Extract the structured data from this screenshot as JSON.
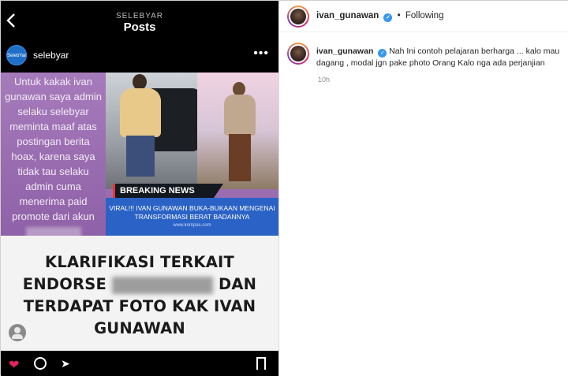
{
  "left_post": {
    "header_subtitle": "SELEBYAR",
    "header_title": "Posts",
    "avatar_text": "SelebYar",
    "account_name": "selebyar",
    "apology_text": "Untuk kakak ivan gunawan saya admin selaku selebyar meminta maaf atas postingan berita hoax, karena saya tidak tau selaku admin cuma menerima paid promote dari akun",
    "breaking_news": "BREAKING NEWS",
    "news_headline": "VIRAL!!! IVAN GUNAWAN BUKA-BUKAAN MENGENAI TRANSFORMASI BERAT BADANNYA",
    "news_source": "www.kompas.com",
    "klarifikasi_line1": "KLARIFIKASI TERKAIT",
    "klarifikasi_line2a": "ENDORSE",
    "klarifikasi_line2b": "DAN",
    "klarifikasi_line3": "TERDAPAT FOTO KAK IVAN",
    "klarifikasi_line4": "GUNAWAN"
  },
  "panel": {
    "header_username": "ivan_gunawan",
    "follow_status": "Following",
    "comment_username": "ivan_gunawan",
    "comment_text": "Nah Ini contoh pelajaran berharga ... kalo mau dagang , modal jgn pake photo Orang Kalo nga ada perjanjian",
    "comment_time": "10h"
  },
  "colors": {
    "verified": "#3897f0",
    "apology_bg": "#9a6db0",
    "news_band": "#2b62c6",
    "heart": "#e0245e"
  }
}
